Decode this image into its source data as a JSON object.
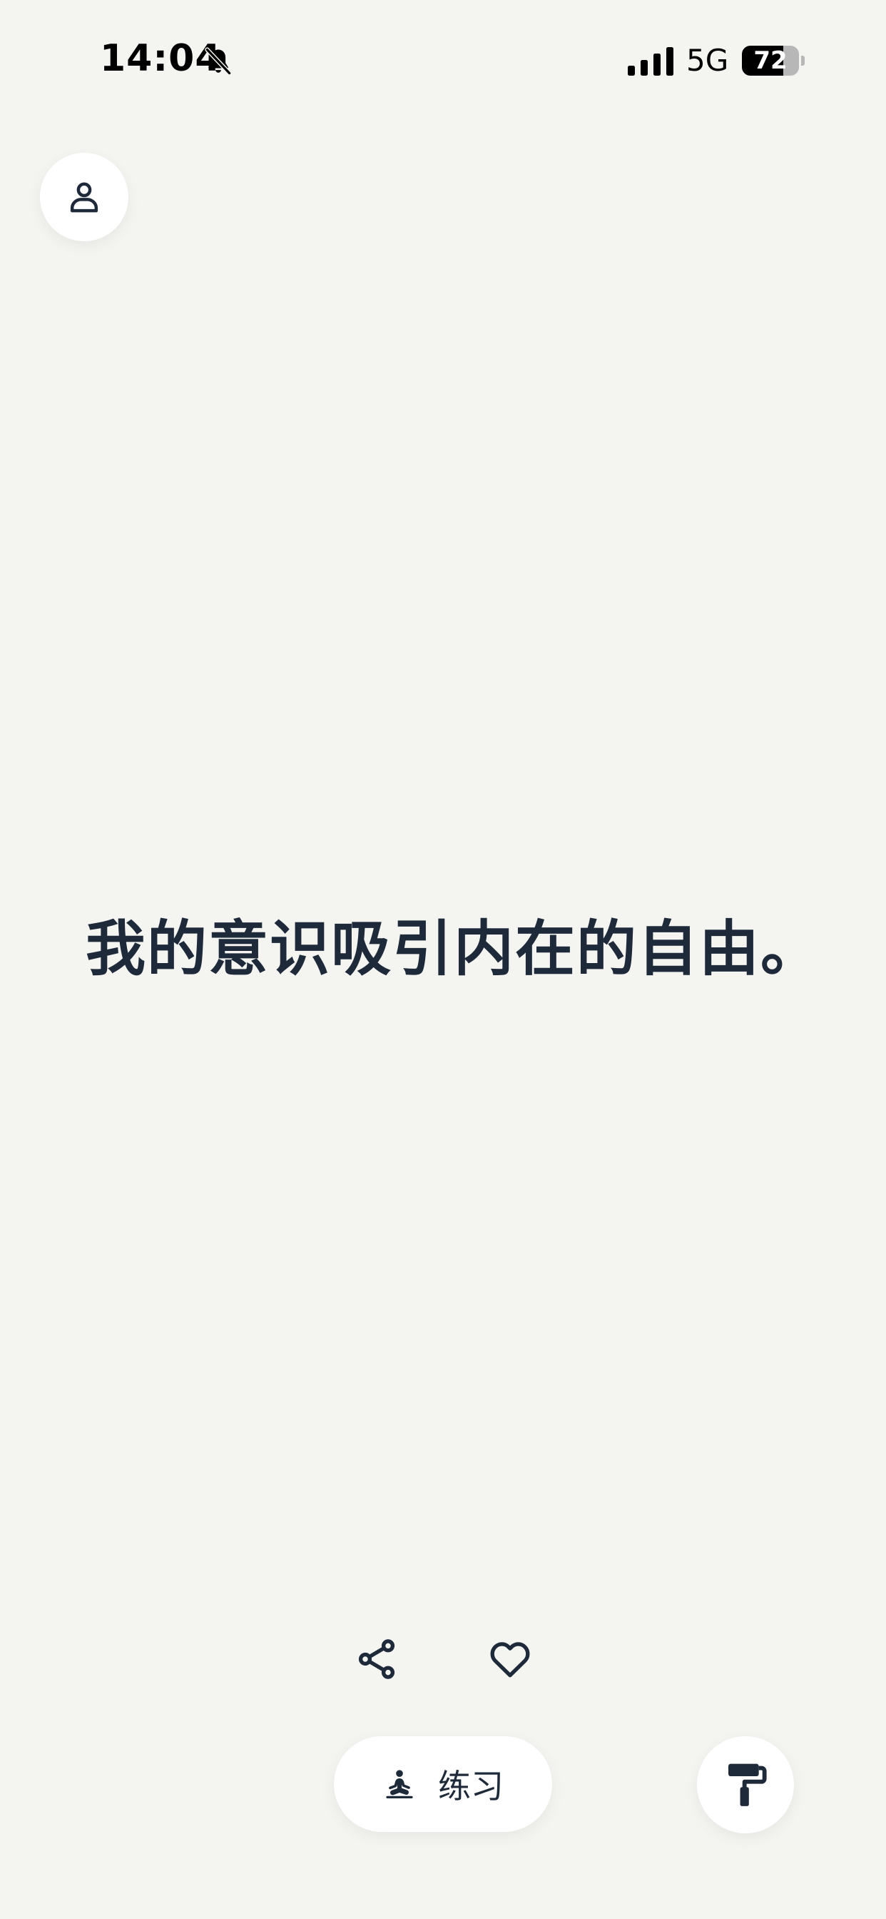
{
  "status_bar": {
    "time": "14:04",
    "network": "5G",
    "battery_level": "72",
    "battery_fraction": 0.72,
    "icons": [
      "bell-slash-icon",
      "signal-icon"
    ]
  },
  "profile": {
    "icon": "person-icon"
  },
  "affirmation": {
    "text": "我的意识吸引内在的自由。"
  },
  "actions": {
    "share_icon": "share-icon",
    "favorite_icon": "heart-icon"
  },
  "bottom_bar": {
    "practice_label": "练习",
    "practice_icon": "meditation-icon",
    "theme_icon": "paint-roller-icon"
  },
  "colors": {
    "background": "#f4f4f1",
    "text": "#1e2a3a",
    "button": "#ffffff"
  }
}
